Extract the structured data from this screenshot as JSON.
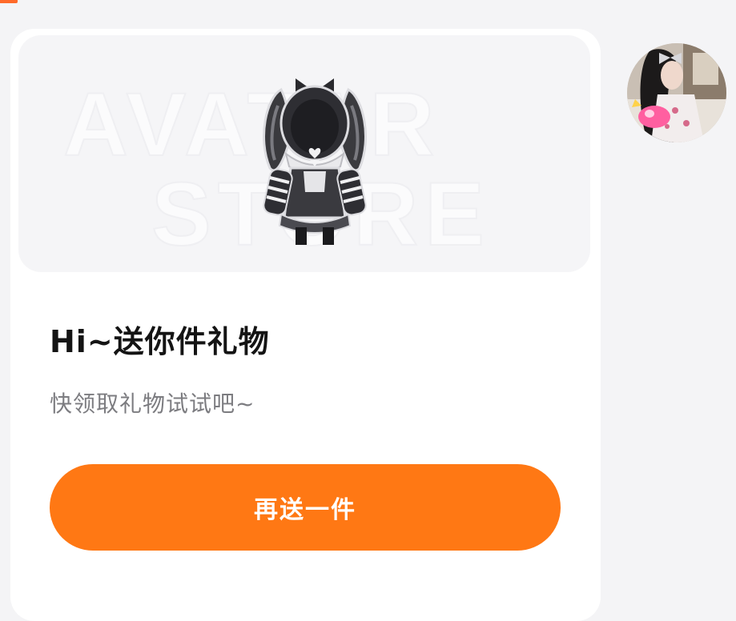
{
  "card": {
    "title": "Hi~送你件礼物",
    "subtitle": "快领取礼物试试吧~",
    "button_label": "再送一件"
  },
  "banner": {
    "watermark_line1": "AVATAR",
    "watermark_line2": "STORE",
    "item_image": "gothic-bunny-outfit-icon"
  },
  "profile": {
    "image": "user-avatar-photo"
  },
  "colors": {
    "accent": "#ff7814",
    "background": "#f4f4f6",
    "card": "#ffffff",
    "banner": "#f5f5f7"
  }
}
